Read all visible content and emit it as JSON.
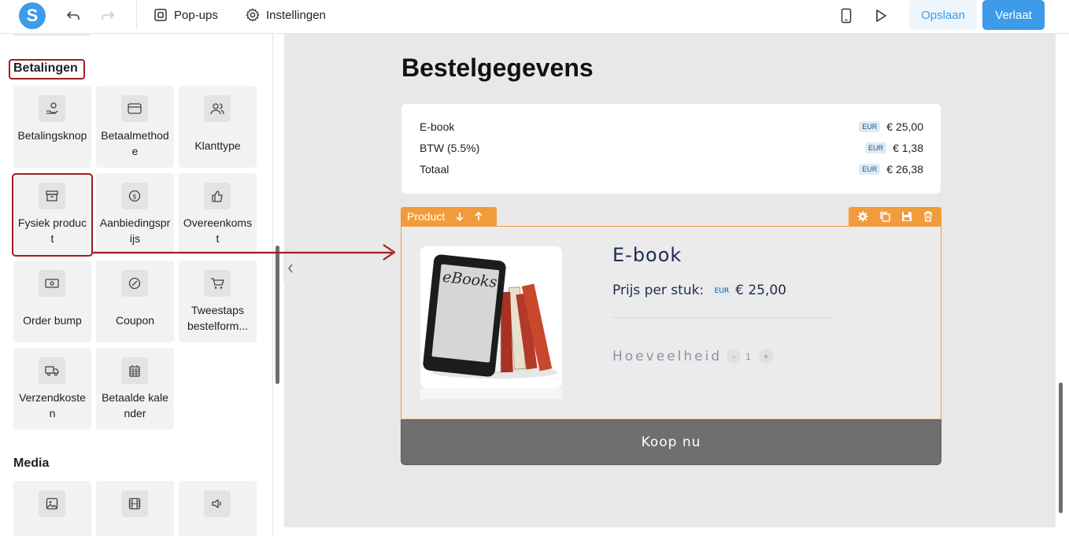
{
  "topbar": {
    "logo_letter": "S",
    "popups_label": "Pop-ups",
    "settings_label": "Instellingen",
    "save_label": "Opslaan",
    "leave_label": "Verlaat",
    "accent": "#3d9be9"
  },
  "sidebar": {
    "payments_title": "Betalingen",
    "payments_items": [
      {
        "label": "Betalingsknop",
        "icon": "hand-coin-icon"
      },
      {
        "label": "Betaalmethode",
        "icon": "credit-card-icon"
      },
      {
        "label": "Klanttype",
        "icon": "users-icon"
      },
      {
        "label": "Fysiek product",
        "icon": "archive-box-icon"
      },
      {
        "label": "Aanbiedingsprijs",
        "icon": "dollar-circle-icon"
      },
      {
        "label": "Overeenkomst",
        "icon": "thumbs-up-icon"
      },
      {
        "label": "Order bump",
        "icon": "banknote-icon"
      },
      {
        "label": "Coupon",
        "icon": "coupon-icon"
      },
      {
        "label": "Tweestaps bestelform...",
        "icon": "cart-icon"
      },
      {
        "label": "Verzendkosten",
        "icon": "truck-icon"
      },
      {
        "label": "Betaalde kalender",
        "icon": "calendar-icon"
      }
    ],
    "media_title": "Media",
    "media_items": [
      {
        "icon": "image-icon"
      },
      {
        "icon": "film-icon"
      },
      {
        "icon": "speaker-icon"
      }
    ],
    "highlight_color": "#a31d1d"
  },
  "canvas": {
    "title": "Bestelgegevens",
    "summary": [
      {
        "label": "E-book",
        "currency": "EUR",
        "amount": "€ 25,00"
      },
      {
        "label": "BTW (5.5%)",
        "currency": "EUR",
        "amount": "€ 1,38"
      },
      {
        "label": "Totaal",
        "currency": "EUR",
        "amount": "€ 26,38"
      }
    ],
    "product_tab_label": "Product",
    "product": {
      "name": "E-book",
      "price_label": "Prijs per stuk:",
      "currency": "EUR",
      "price": "€ 25,00",
      "quantity_label": "Hoeveelheid",
      "minus": "-",
      "quantity": "1",
      "plus": "+",
      "image_text": "eBooks"
    },
    "buy_label": "Koop nu",
    "accent": "#f29b3a"
  }
}
